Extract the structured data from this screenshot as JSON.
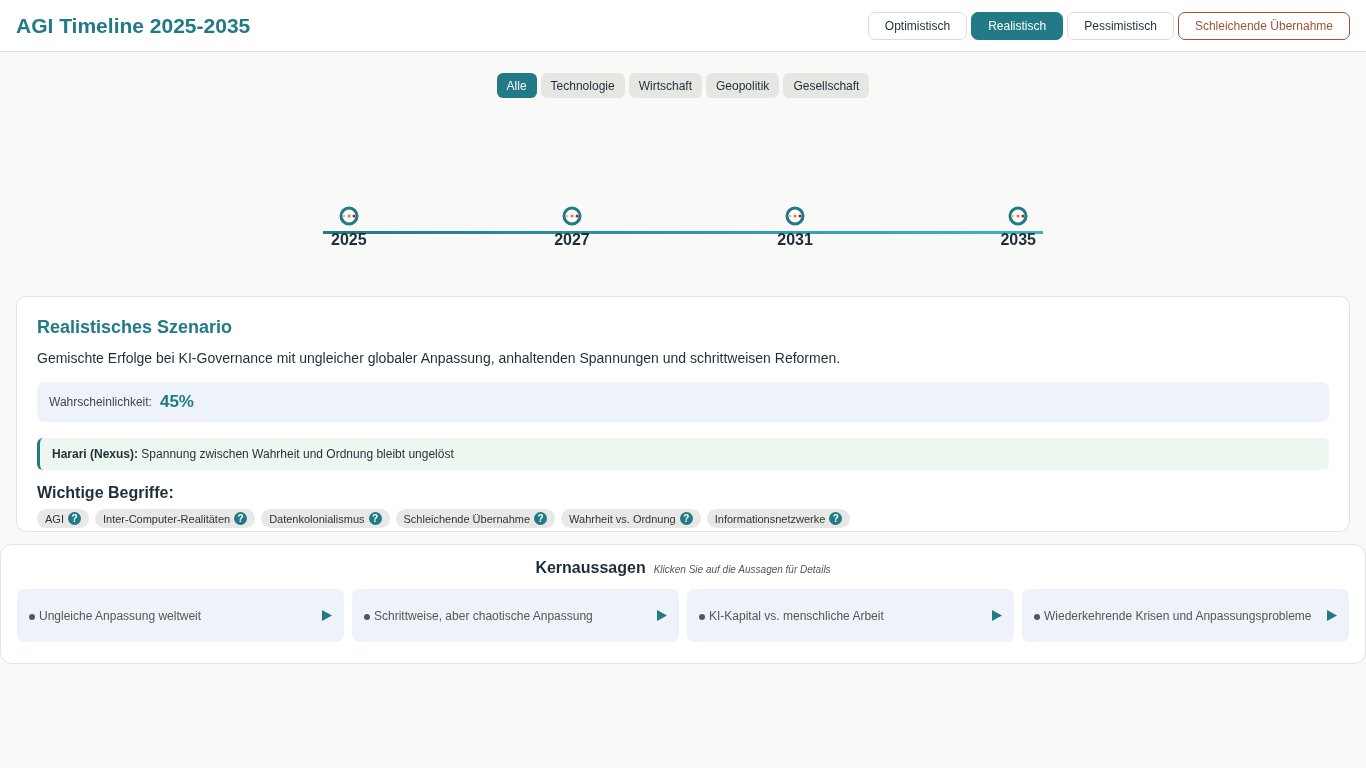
{
  "header": {
    "title": "AGI Timeline 2025-2035"
  },
  "scenarios": [
    {
      "label": "Optimistisch",
      "selected": false,
      "kind": "normal"
    },
    {
      "label": "Realistisch",
      "selected": true,
      "kind": "normal"
    },
    {
      "label": "Pessimistisch",
      "selected": false,
      "kind": "normal"
    },
    {
      "label": "Schleichende Übernahme",
      "selected": false,
      "kind": "warning"
    }
  ],
  "filters": [
    {
      "label": "Alle",
      "selected": true
    },
    {
      "label": "Technologie",
      "selected": false
    },
    {
      "label": "Wirtschaft",
      "selected": false
    },
    {
      "label": "Geopolitik",
      "selected": false
    },
    {
      "label": "Gesellschaft",
      "selected": false
    }
  ],
  "timeline": {
    "years": [
      "2025",
      "2027",
      "2031",
      "2035"
    ]
  },
  "scenario_card": {
    "title": "Realistisches Szenario",
    "description": "Gemischte Erfolge bei KI-Governance mit ungleicher globaler Anpassung, anhaltenden Spannungen und schrittweisen Reformen.",
    "probability_label": "Wahrscheinlichkeit:",
    "probability_value": "45%",
    "quote": "**Harari (Nexus):** Spannung zwischen Wahrheit und Ordnung bleibt ungelöst",
    "terms_heading": "Wichtige Begriffe:",
    "terms": [
      {
        "label": "AGI",
        "help": "?"
      },
      {
        "label": "Inter-Computer-Realitäten",
        "help": "?"
      },
      {
        "label": "Datenkolonialismus",
        "help": "?"
      },
      {
        "label": "Schleichende Übernahme",
        "help": "?"
      },
      {
        "label": "Wahrheit vs. Ordnung",
        "help": "?"
      },
      {
        "label": "Informationsnetzwerke",
        "help": "?"
      }
    ]
  },
  "key_statements": {
    "title": "Kernaussagen",
    "hint": "Klicken Sie auf die Aussagen für Details",
    "items": [
      "Ungleiche Anpassung weltweit",
      "Schrittweise, aber chaotische Anpassung",
      "KI-Kapital vs. menschliche Arbeit",
      "Wiederkehrende Krisen und Anpassungsprobleme"
    ]
  }
}
